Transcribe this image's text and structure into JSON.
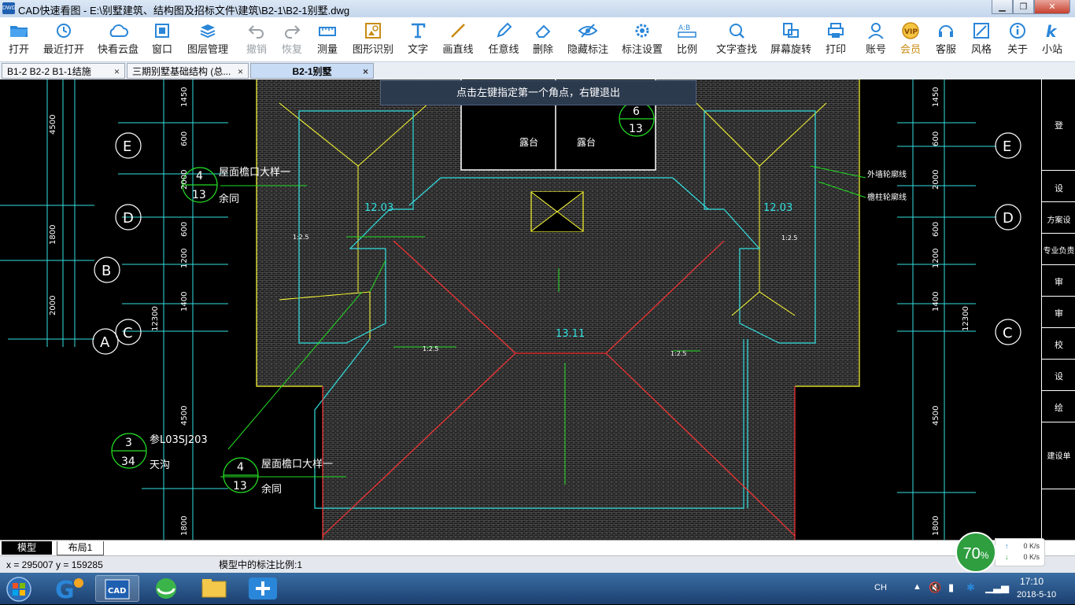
{
  "window": {
    "icon_label": "DWG",
    "title": "CAD快速看图 - E:\\别墅建筑、结构图及招标文件\\建筑\\B2-1\\B2-1别墅.dwg",
    "minimize_icon": "minimize-icon",
    "maximize_icon": "maximize-icon",
    "close_icon": "close-icon"
  },
  "toolbar": {
    "open": "打开",
    "recent": "最近打开",
    "cloud": "快看云盘",
    "window": "窗口",
    "layers": "图层管理",
    "undo": "撤销",
    "redo": "恢复",
    "measure": "测量",
    "shape_recognize": "图形识别",
    "text": "文字",
    "line": "画直线",
    "freehand": "任意线",
    "delete": "删除",
    "hide_annot": "隐藏标注",
    "annot_settings": "标注设置",
    "scale": "比例",
    "text_search": "文字查找",
    "rotate": "屏幕旋转",
    "print": "打印",
    "account": "账号",
    "member": "会员",
    "service": "客服",
    "style": "风格",
    "about": "关于",
    "site": "小站"
  },
  "tabs": [
    {
      "label": "B1-2 B2-2 B1-1结施"
    },
    {
      "label": "三期别墅基础结构 (总..."
    },
    {
      "label": "B2-1别墅"
    }
  ],
  "tab_close": "×",
  "hint": "点击左键指定第一个角点，右键退出",
  "drawing": {
    "axes": [
      "E",
      "D",
      "B",
      "A",
      "C",
      "E",
      "D",
      "C"
    ],
    "left_dims": [
      "4500",
      "1800",
      "2000",
      "1450",
      "600",
      "2000",
      "600",
      "1200",
      "1400",
      "12300",
      "4500",
      "1800"
    ],
    "right_dims": [
      "1450",
      "600",
      "2000",
      "600",
      "1200",
      "1400",
      "12300",
      "4500",
      "1800"
    ],
    "callout_top_num": "4",
    "callout_top_den": "13",
    "callout_top_text": "屋面檐口大样一",
    "callout_top_sub": "余同",
    "callout_mid_num": "6",
    "callout_mid_den": "13",
    "callout_ref_num": "3",
    "callout_ref_den": "34",
    "callout_ref_text": "参L03SJ203",
    "callout_ref_sub": "天沟",
    "callout_bot_num": "4",
    "callout_bot_den": "13",
    "callout_bot_text": "屋面檐口大样一",
    "callout_bot_sub": "余同",
    "label_terrace": "露台",
    "elev_left": "12.03",
    "elev_right": "12.03",
    "elev_center": "13.11",
    "slope": "1:2.5",
    "outer_wall": "外墙轮廓线",
    "eave_line": "檐柱轮廓线",
    "side_labels": [
      "登",
      "设",
      "方案设",
      "专业负责",
      "审",
      "审",
      "校",
      "设",
      "绘",
      "建设单"
    ]
  },
  "layout_tabs": {
    "model": "模型",
    "layout1": "布局1"
  },
  "status": {
    "coords": "x = 295007  y = 159285",
    "scale_text": "模型中的标注比例:1"
  },
  "net_widget": {
    "percent": "70",
    "percent_sign": "%",
    "up": "0 K/s",
    "down": "0 K/s"
  },
  "tray": {
    "lang": "CH",
    "time": "17:10",
    "date": "2018-5-10"
  },
  "taskbar_apps": [
    "start-orb",
    "browser-app",
    "cad-app",
    "browser-360-app",
    "file-explorer-app",
    "feiq-app"
  ]
}
